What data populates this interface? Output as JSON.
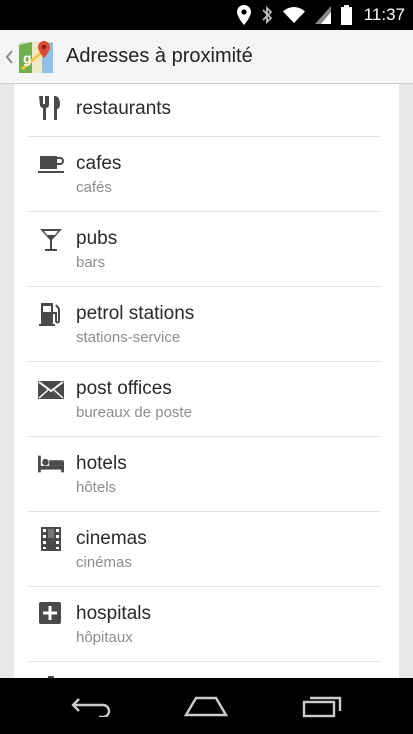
{
  "status_bar": {
    "time": "11:37",
    "icons": [
      "location-icon",
      "bluetooth-icon",
      "wifi-icon",
      "signal-icon",
      "battery-icon"
    ]
  },
  "action_bar": {
    "title": "Adresses à proximité",
    "logo": "maps-logo-icon",
    "up": "chevron-left-icon"
  },
  "places": [
    {
      "label": "restaurants",
      "sublabel": "",
      "icon": "fork-knife-icon"
    },
    {
      "label": "cafes",
      "sublabel": "cafés",
      "icon": "coffee-cup-icon"
    },
    {
      "label": "pubs",
      "sublabel": "bars",
      "icon": "cocktail-glass-icon"
    },
    {
      "label": "petrol stations",
      "sublabel": "stations-service",
      "icon": "fuel-pump-icon"
    },
    {
      "label": "post offices",
      "sublabel": "bureaux de poste",
      "icon": "envelope-icon"
    },
    {
      "label": "hotels",
      "sublabel": "hôtels",
      "icon": "bed-icon"
    },
    {
      "label": "cinemas",
      "sublabel": "cinémas",
      "icon": "film-strip-icon"
    },
    {
      "label": "hospitals",
      "sublabel": "hôpitaux",
      "icon": "medical-cross-icon"
    }
  ],
  "nav_bar": [
    "back-icon",
    "home-icon",
    "recent-apps-icon"
  ],
  "colors": {
    "status_bar": "#000000",
    "action_bar": "#f5f5f5",
    "background": "#e8e8e8",
    "card": "#ffffff",
    "icon": "#4a4a4a",
    "primary_text": "#2a2a2a",
    "secondary_text": "#8d8d8d"
  }
}
